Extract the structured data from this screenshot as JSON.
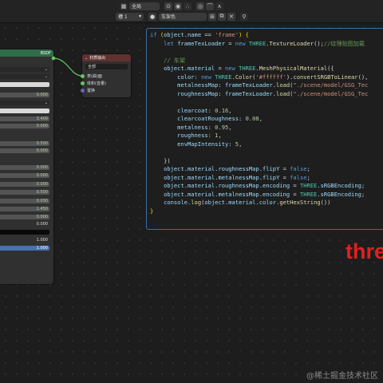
{
  "header": {
    "view_menu": "全局",
    "slot_label": "槽 1",
    "material_name": "车架色"
  },
  "left_node": {
    "output_label": "BSDF",
    "rows": [
      {
        "value": "0.000"
      },
      {
        "value": "3.400"
      },
      {
        "value": "0.000"
      },
      {
        "value": "0.500"
      },
      {
        "value": "0.000"
      },
      {
        "value": "0.000"
      },
      {
        "value": "0.000"
      },
      {
        "value": "0.000"
      },
      {
        "value": "0.500"
      },
      {
        "value": "0.030"
      },
      {
        "value": "1.450"
      },
      {
        "value": "0.000"
      },
      {
        "value": "0.000"
      },
      {
        "value": "1.000"
      },
      {
        "value": "1.000"
      }
    ]
  },
  "frame_node": {
    "title": "材质输出",
    "target": "全部",
    "outputs": [
      "表(曲)面",
      "体积(音量)",
      "置换"
    ]
  },
  "code_lines": [
    "if (object.name == 'frame') {",
    "    let frameTexLoader = new THREE.TextureLoader();//纹理贴图加载",
    "",
    "    // 车架",
    "    object.material = new THREE.MeshPhysicalMaterial({",
    "        color: new THREE.Color('#ffffff').convertSRGBToLinear(),",
    "        metalnessMap: frameTexLoader.load(\"./scene/model/GSG_Tec",
    "        roughnessMap: frameTexLoader.load(\"./scene/model/GSG_Tec",
    "",
    "        clearcoat: 0.16,",
    "        clearcoatRoughness: 0.08,",
    "        metalness: 0.95,",
    "        roughness: 1,",
    "        envMapIntensity: 5,",
    "",
    "    })",
    "    object.material.roughnessMap.flipY = false;",
    "    object.material.metalnessMap.flipY = false;",
    "    object.material.roughnessMap.encoding = THREE.sRGBEncoding;",
    "    object.material.metalnessMap.encoding = THREE.sRGBEncoding;",
    "    console.log(object.material.color.getHexString())",
    "}"
  ],
  "overlay_text": "thre",
  "watermark": "@稀土掘金技术社区",
  "colors": {
    "node_green": "#2c6e49",
    "frame_red": "#613131",
    "code_border": "#3b6ea0",
    "accent_red": "#e02020"
  }
}
